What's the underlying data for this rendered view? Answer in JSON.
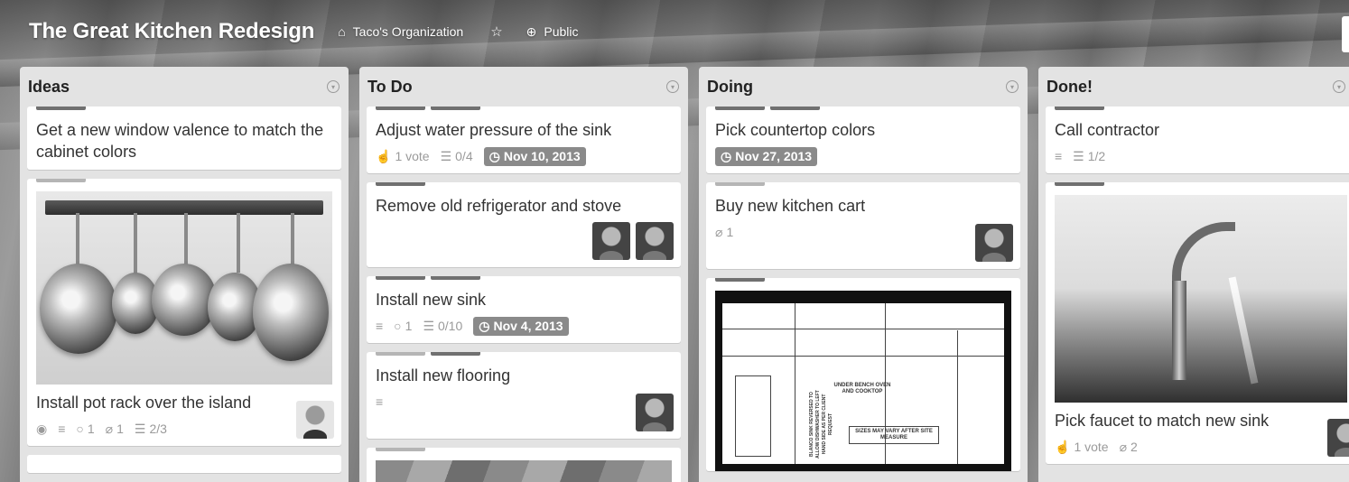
{
  "header": {
    "board_title": "The Great Kitchen Redesign",
    "organization": "Taco's Organization",
    "visibility": "Public"
  },
  "icons": {
    "organization": "org-icon",
    "star": "star-icon",
    "visibility": "globe-icon",
    "list_menu": "chevron-circle-icon"
  },
  "lists": [
    {
      "title": "Ideas",
      "cards": [
        {
          "title": "Get a new window valence to match the cabinet colors",
          "labels": [
            "dark"
          ]
        },
        {
          "title": "Install pot rack over the island",
          "labels": [
            "light"
          ],
          "badges": {
            "comments": "1",
            "attachments": "1",
            "checklist": "2/3"
          }
        }
      ]
    },
    {
      "title": "To Do",
      "cards": [
        {
          "title": "Adjust water pressure of the sink",
          "labels": [
            "dark",
            "dark"
          ],
          "badges": {
            "votes": "1 vote",
            "checklist": "0/4",
            "due": "Nov 10, 2013"
          }
        },
        {
          "title": "Remove old refrigerator and stove",
          "labels": [
            "dark"
          ]
        },
        {
          "title": "Install new sink",
          "labels": [
            "dark",
            "dark"
          ],
          "badges": {
            "comments": "1",
            "checklist": "0/10",
            "due": "Nov 4, 2013"
          }
        },
        {
          "title": "Install new flooring",
          "labels": [
            "light",
            "dark"
          ]
        }
      ]
    },
    {
      "title": "Doing",
      "cards": [
        {
          "title": "Pick countertop colors",
          "labels": [
            "dark",
            "dark"
          ],
          "badges": {
            "due": "Nov 27, 2013"
          }
        },
        {
          "title": "Buy new kitchen cart",
          "labels": [
            "light"
          ],
          "badges": {
            "attachments": "1"
          }
        },
        {
          "title": "",
          "labels": [
            "dark"
          ],
          "plan_text": {
            "under_bench": "UNDER BENCH OVEN AND COOKTOP",
            "sizes": "SIZES MAY VARY AFTER SITE MEASURE",
            "blanco": "BLANCO SINK REVERSED TO ALLOW DISHWASHER TO LEFT HAND SIDE AS PER CLIENT REQUEST"
          }
        }
      ]
    },
    {
      "title": "Done!",
      "cards": [
        {
          "title": "Call contractor",
          "labels": [
            "dark"
          ],
          "badges": {
            "checklist": "1/2"
          }
        },
        {
          "title": "Pick faucet to match new sink",
          "labels": [
            "dark"
          ],
          "badges": {
            "votes": "1 vote",
            "attachments": "2"
          }
        }
      ]
    }
  ]
}
